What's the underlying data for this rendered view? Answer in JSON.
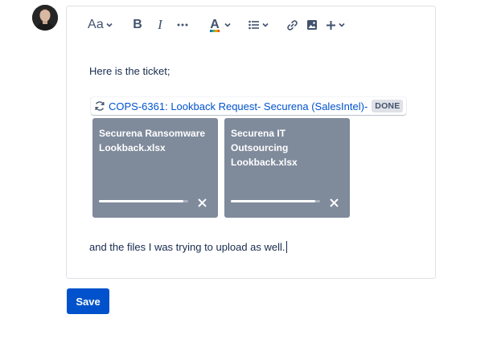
{
  "user": {
    "avatar_icon": "user-avatar"
  },
  "toolbar": {
    "text_style_label": "Aa",
    "bold_label": "B",
    "italic_label": "I",
    "more_label": "···",
    "color_label": "A",
    "icons": {
      "text_style": "chevron-down-icon",
      "list": "bullet-list-icon",
      "link": "link-icon",
      "image": "image-icon",
      "insert": "plus-icon"
    }
  },
  "editor": {
    "paragraph1": "Here is the ticket;",
    "smart_link": {
      "icon": "sync-icon",
      "text": "COPS-6361: Lookback Request- Securena (SalesIntel)-",
      "status": "DONE"
    },
    "files": [
      {
        "name": "Securena Ransomware Lookback.xlsx",
        "progress": 0.95
      },
      {
        "name": "Securena IT Outsourcing Lookback.xlsx",
        "progress": 0.95
      }
    ],
    "paragraph2": "and the files I was trying to upload as well."
  },
  "actions": {
    "save_label": "Save"
  },
  "colors": {
    "primary": "#0052cc",
    "file_card": "#7f8a9b",
    "border": "#dfe1e6",
    "text": "#172b4d"
  }
}
